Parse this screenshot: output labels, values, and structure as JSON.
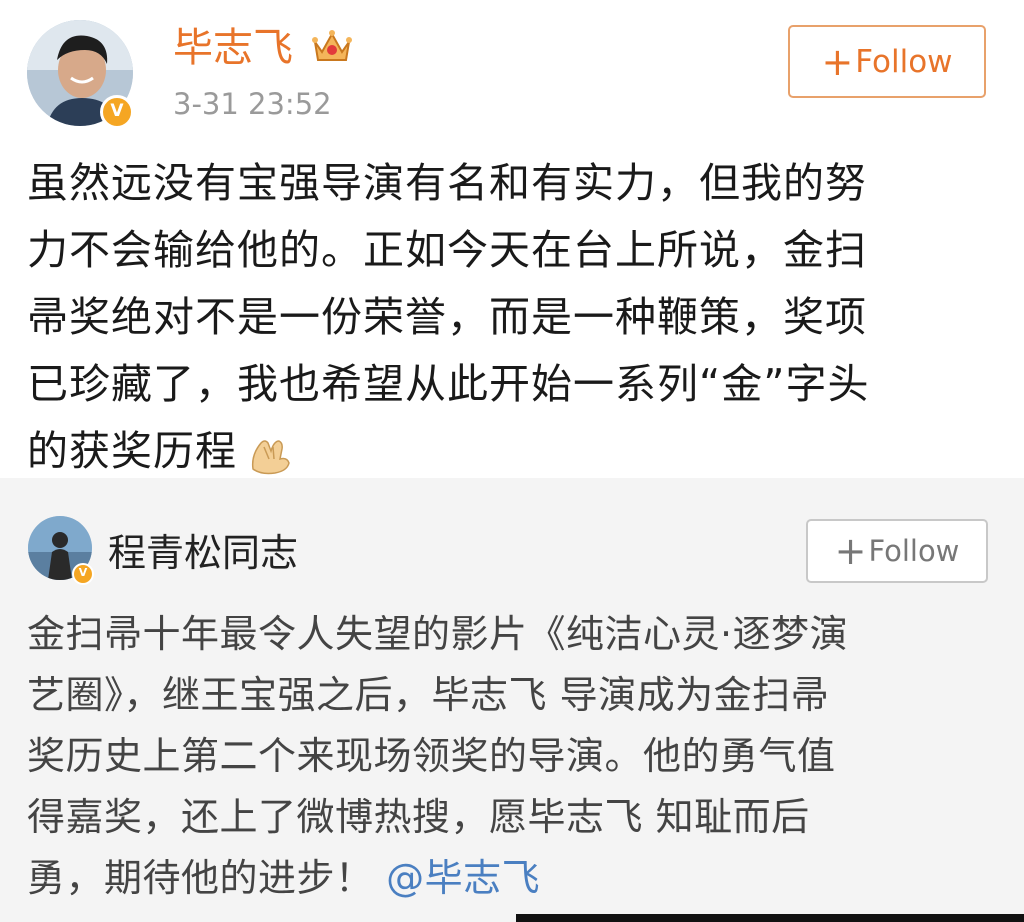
{
  "post": {
    "username": "毕志飞",
    "timestamp": "3-31 23:52",
    "follow_label": "Follow",
    "text_lines": [
      "虽然远没有宝强导演有名和有实力，但我的努",
      "力不会输给他的。正如今天在台上所说，金扫",
      "帚奖绝对不是一份荣誉，而是一种鞭策，奖项",
      "已珍藏了，我也希望从此开始一系列“金”字头",
      "的获奖历程"
    ],
    "emoji": "clap-hands-icon"
  },
  "repost": {
    "username": "程青松同志",
    "follow_label": "Follow",
    "text_lines": [
      "金扫帚十年最令人失望的影片《纯洁心灵·逐梦演",
      "艺圈》，继王宝强之后，毕志飞 导演成为金扫帚",
      "奖历史上第二个来现场领奖的导演。他的勇气值",
      "得嘉奖，还上了微博热搜，愿毕志飞 知耻而后",
      "勇，期待他的进步！"
    ],
    "mention": "@毕志飞"
  },
  "colors": {
    "username": "#e8742a",
    "verified_badge": "#f5a623",
    "mention": "#4a7fc1",
    "repost_background": "#f4f4f4"
  },
  "icons": {
    "plus": "+",
    "verified": "V"
  }
}
